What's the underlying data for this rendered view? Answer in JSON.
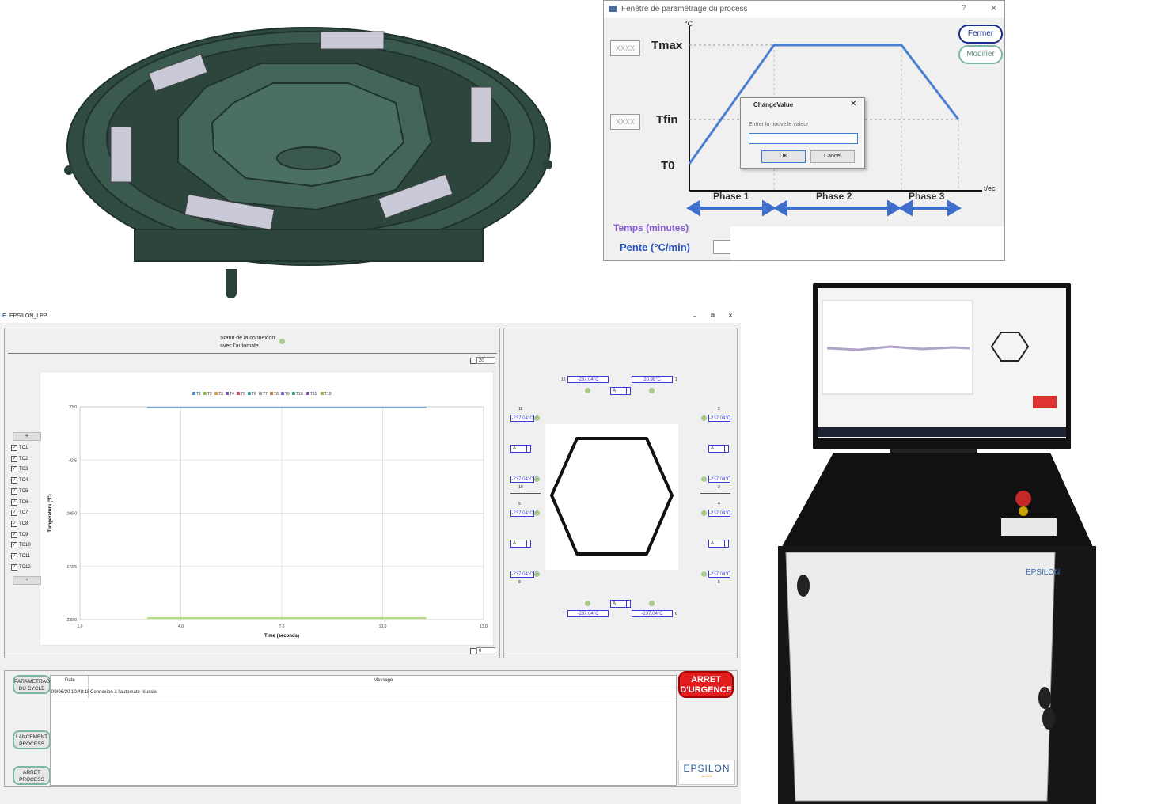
{
  "profile_dialog": {
    "title": "Fenêtre de paramétrage du process",
    "btn_top": "Fermer",
    "btn_second": "Modifier",
    "labels": {
      "tmax": "Tmax",
      "tfin": "Tfin",
      "t0": "T0",
      "phase1": "Phase 1",
      "phase2": "Phase 2",
      "phase3": "Phase 3",
      "yaxis": "°C",
      "xaxis": "t/ec"
    },
    "bottom_labels": {
      "time": "Temps (minutes)",
      "pente": "Pente (°C/min)"
    },
    "small_field_1": "XXXX",
    "small_field_2": "XXXX",
    "input_dialog": {
      "title": "ChangeValue",
      "prompt": "Entrer la nouvelle valeur",
      "value": "",
      "ok": "OK",
      "cancel": "Cancel"
    }
  },
  "app": {
    "title": "EPSILON_LPP",
    "title_icon": "E",
    "connection_status": "Statut de la connexion avec l'automate",
    "top_spinner": "20",
    "bottom_spinner": "0",
    "plus": "+",
    "minus": "-",
    "tc_labels": [
      "TC1",
      "TC2",
      "TC3",
      "TC4",
      "TC5",
      "TC6",
      "TC7",
      "TC8",
      "TC9",
      "TC10",
      "TC11",
      "TC12"
    ],
    "sidebar": {
      "param": "PARAMETRAGE DU CYCLE",
      "launch": "LANCEMENT PROCESS",
      "stop": "ARRET PROCESS"
    },
    "log": {
      "col_date": "Date",
      "col_message": "Message",
      "rows": [
        {
          "date": "09/06/20 10:48:18",
          "message": "Connexion à l'automate réussie."
        }
      ]
    },
    "emergency": "ARRET D'URGENCE",
    "logo": "EPSILON",
    "logo_sub": "ALCEN",
    "sensors": {
      "s12": "-237.04°C",
      "s1": "20.98°C",
      "s11": "-237.04°C",
      "s2": "-237.04°C",
      "s10": "-237.04°C",
      "s3": "-237.04°C",
      "s9": "-237.04°C",
      "s4": "-237.04°C",
      "s8": "-237.04°C",
      "s5": "-237.04°C",
      "s7": "-237.04°C",
      "s6": "-237.04°C",
      "a": "A"
    },
    "sensor_numbers": [
      "12",
      "1",
      "11",
      "2",
      "10",
      "3",
      "9",
      "4",
      "8",
      "5",
      "7",
      "6"
    ]
  },
  "cabinet": {
    "brand": "EPSILON"
  },
  "chart_data": {
    "type": "line",
    "legend": [
      "T1",
      "T2",
      "T3",
      "T4",
      "T5",
      "T6",
      "T7",
      "T8",
      "T9",
      "T10",
      "T11",
      "T12"
    ],
    "xlabel": "Time (seconds)",
    "ylabel": "Temperature (°C)",
    "xlim": [
      1.0,
      13.0
    ],
    "ylim": [
      -239.0,
      23.0
    ],
    "xticks": [
      "1.0",
      "4.0",
      "7.0",
      "10.0",
      "13.0"
    ],
    "yticks": [
      "23.0",
      "-42.5",
      "-108.0",
      "-173.5",
      "-239.0"
    ],
    "grid": true,
    "series": [
      {
        "name": "T1",
        "color": "#4a90d9",
        "x": [
          3.0,
          11.3
        ],
        "y": [
          22.0,
          22.0
        ]
      },
      {
        "name": "T2",
        "color": "#8cc63f",
        "x": [
          3.0,
          11.3
        ],
        "y": [
          -237.04,
          -237.04
        ]
      }
    ]
  }
}
